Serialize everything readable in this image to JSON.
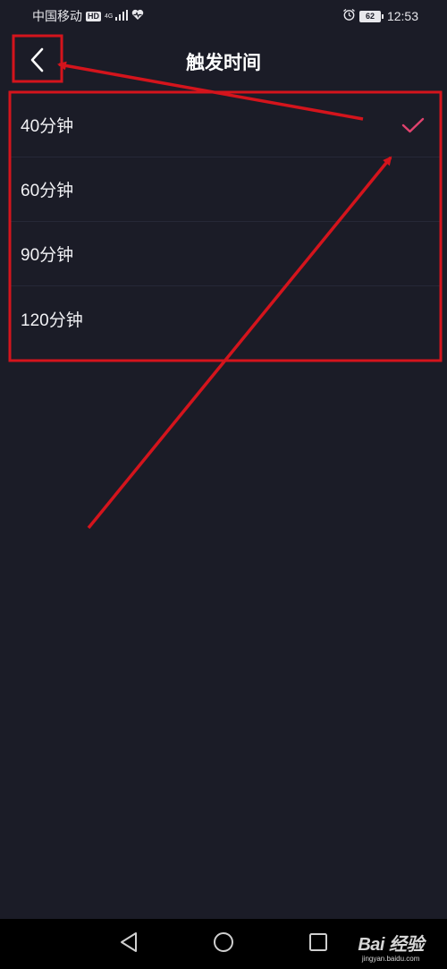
{
  "status_bar": {
    "carrier": "中国移动",
    "hd_badge": "HD",
    "network": "4G",
    "battery_level": "62",
    "time": "12:53"
  },
  "header": {
    "title": "触发时间",
    "back_icon": "chevron-left-icon"
  },
  "options": [
    {
      "label": "40分钟",
      "selected": true
    },
    {
      "label": "60分钟",
      "selected": false
    },
    {
      "label": "90分钟",
      "selected": false
    },
    {
      "label": "120分钟",
      "selected": false
    }
  ],
  "colors": {
    "background": "#1b1c27",
    "check_accent": "#e0426e",
    "annotation_red": "#d4141c",
    "nav_bar": "#000000"
  },
  "nav": {
    "back_icon": "triangle-back-icon",
    "home_icon": "circle-home-icon",
    "recent_icon": "square-recent-icon"
  },
  "watermark": {
    "logo": "Bai 经验",
    "url": "jingyan.baidu.com"
  }
}
